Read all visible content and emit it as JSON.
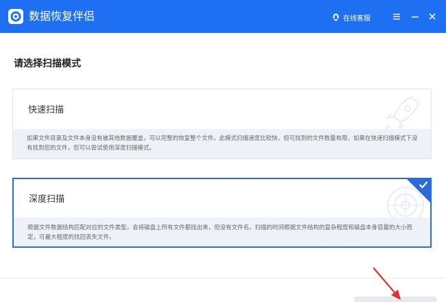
{
  "app": {
    "title": "数据恢复伴侣"
  },
  "header": {
    "service_label": "在线客服"
  },
  "main": {
    "heading": "请选择扫描模式",
    "modes": [
      {
        "title": "快速扫描",
        "description": "如果文件目录及文件本身没有被其他数据覆盖，可以完整的恢复整个文件。此模式扫描速度比较快，但可找到的文件数量有限，如果在快速扫描模式下没有找到您的文件，您可以尝试使用深度扫描模式。",
        "selected": false
      },
      {
        "title": "深度扫描",
        "description": "根据文件数据结构匹配对应的文件类型，会将磁盘上所有文件都找出来，但没有文件名。扫描的时间根据文件结构的复杂程度和磁盘本身容量的大小而定，可最大程度的找回丢失文件。",
        "selected": true
      }
    ]
  },
  "colors": {
    "accent": "#1f6ff2",
    "selected_border": "#2b6cd9",
    "desc_bg": "#eef2f8",
    "arrow": "#e03030"
  }
}
